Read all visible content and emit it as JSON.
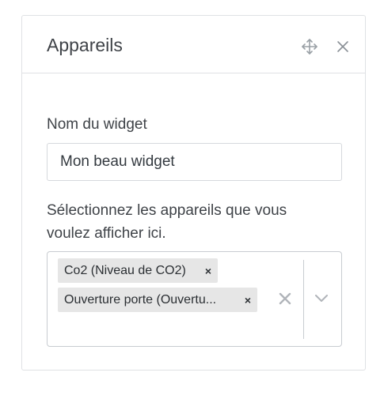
{
  "card": {
    "title": "Appareils"
  },
  "form": {
    "name_label": "Nom du widget",
    "name_value": "Mon beau widget",
    "devices_label": "Sélectionnez les appareils que vous voulez afficher ici.",
    "selected_devices": [
      {
        "label": "Co2 (Niveau de CO2)",
        "remove": "×"
      },
      {
        "label": "Ouverture porte (Ouvertu...",
        "remove": "×"
      }
    ]
  },
  "icons": {
    "move": "move-arrows-icon",
    "close": "close-icon",
    "clear": "clear-icon",
    "dropdown": "chevron-down-icon"
  },
  "colors": {
    "border": "#dfe1e4",
    "chip_bg": "#e6e6e6",
    "icon_gray": "#9aa0a6"
  }
}
